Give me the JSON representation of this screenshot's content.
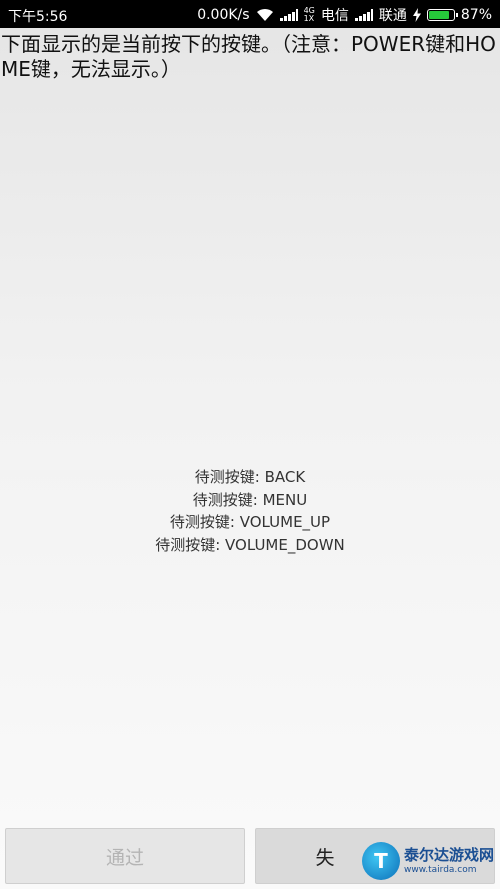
{
  "status_bar": {
    "time": "下午5:56",
    "net_speed": "0.00K/s",
    "network_badge_top": "4G",
    "network_badge_bottom": "1X",
    "carrier1": "电信",
    "carrier2": "联通",
    "battery_percent": "87%",
    "battery_level": 0.87,
    "icons": [
      "wifi-icon",
      "signal-icon",
      "charging-icon",
      "battery-icon"
    ]
  },
  "notice": "下面显示的是当前按下的按键。（注意：POWER键和HOME键，无法显示。）",
  "pending_keys": [
    "待测按键: BACK",
    "待测按键: MENU",
    "待测按键: VOLUME_UP",
    "待测按键: VOLUME_DOWN"
  ],
  "buttons": {
    "pass_label": "通过",
    "fail_label": "失"
  },
  "watermark": {
    "logo_letter": "T",
    "title": "泰尔达游戏网",
    "url": "www.tairda.com"
  },
  "colors": {
    "status_bar_bg": "#000000",
    "battery_fill": "#26c83a",
    "disabled_text": "#b4b4b4"
  }
}
